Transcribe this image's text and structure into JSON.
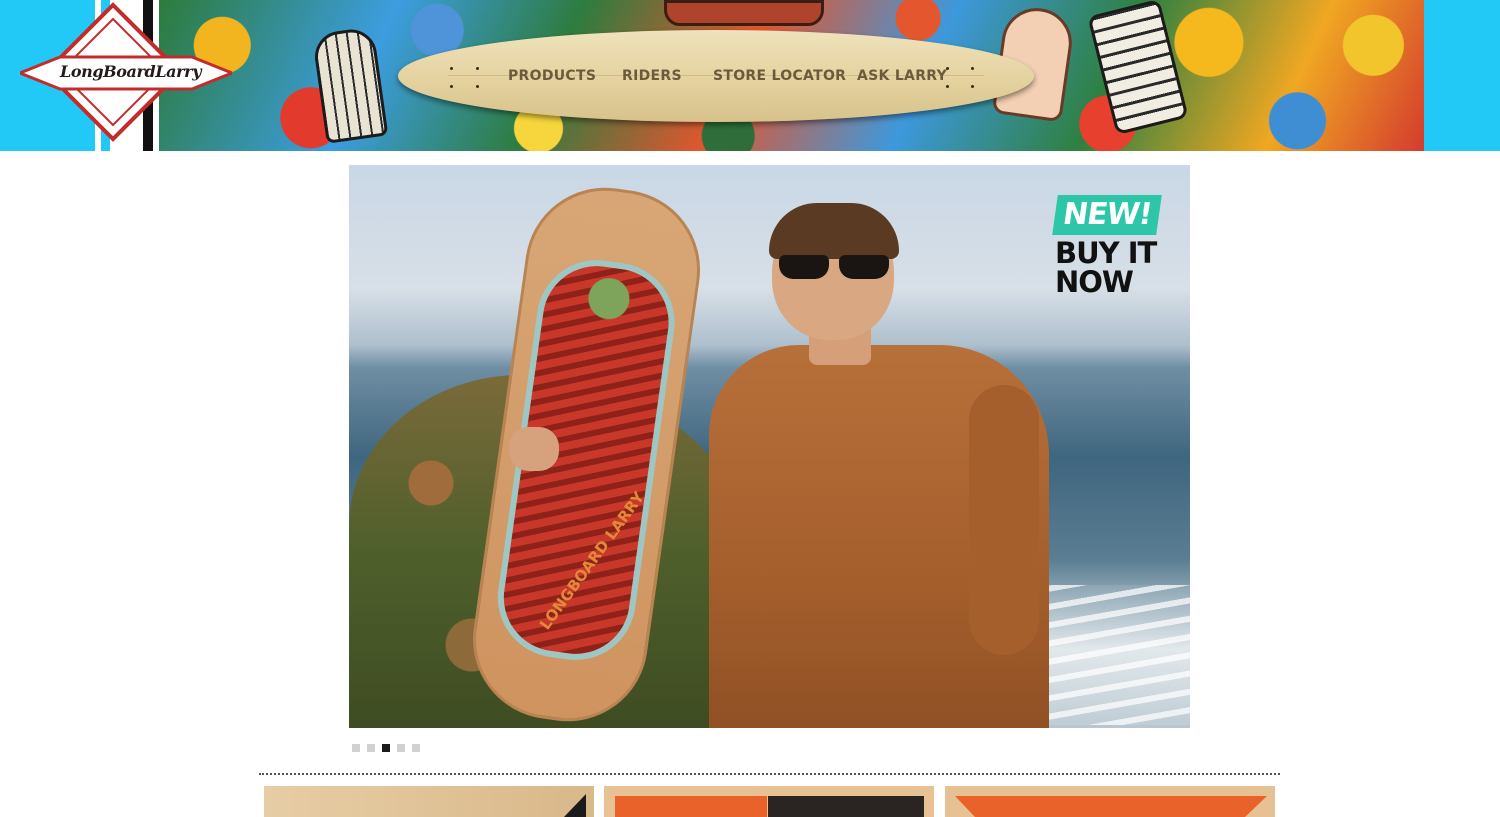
{
  "brand": {
    "logo_text": "LongBoardLarry",
    "logo_colors": {
      "red": "#c42b2b",
      "white": "#ffffff",
      "dark": "#231a19"
    }
  },
  "header": {
    "background": "#22c8f6",
    "nav": [
      {
        "label": "PRODUCTS"
      },
      {
        "label": "RIDERS"
      },
      {
        "label": "STORE LOCATOR"
      },
      {
        "label": "ASK LARRY"
      }
    ]
  },
  "slider": {
    "promo": {
      "badge": "NEW!",
      "line1": "BUY IT",
      "line2": "NOW"
    },
    "deck_print": "LONGBOARD LARRY",
    "slides_total": 5,
    "active_slide": 3
  },
  "tiles": [
    {
      "name": "product-tile-1"
    },
    {
      "name": "product-tile-2"
    },
    {
      "name": "product-tile-3"
    }
  ],
  "colors": {
    "accent_teal": "#2ec6a8",
    "pager_active": "#1b1b1b",
    "pager_inactive": "#d1d1d1"
  }
}
